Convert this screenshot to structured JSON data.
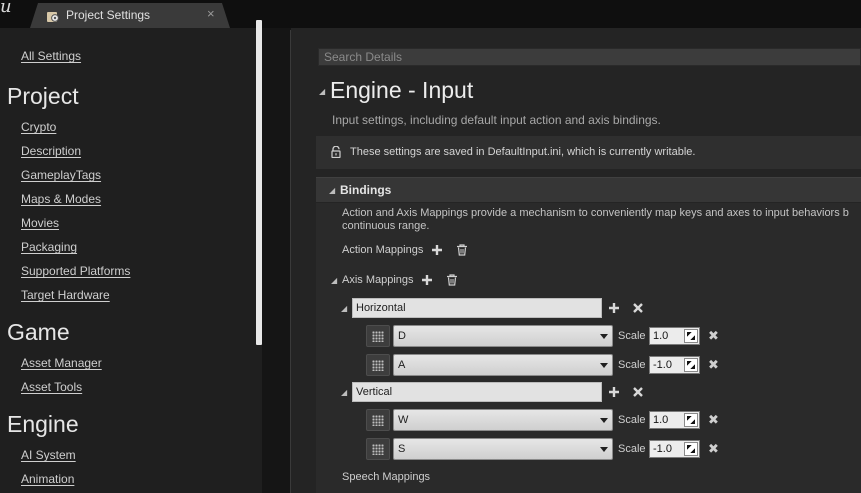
{
  "window": {
    "tab_label": "Project Settings",
    "tab_close": "×"
  },
  "categories": {
    "all_settings": "All Settings",
    "sections": [
      {
        "title": "Project",
        "items": [
          "Crypto",
          "Description",
          "GameplayTags",
          "Maps & Modes",
          "Movies",
          "Packaging",
          "Supported Platforms",
          "Target Hardware"
        ]
      },
      {
        "title": "Game",
        "items": [
          "Asset Manager",
          "Asset Tools"
        ]
      },
      {
        "title": "Engine",
        "items": [
          "AI System",
          "Animation"
        ]
      }
    ]
  },
  "details": {
    "search_placeholder": "Search Details",
    "title": "Engine - Input",
    "description": "Input settings, including default input action and axis bindings.",
    "notice": "These settings are saved in DefaultInput.ini, which is currently writable.",
    "bindings": {
      "title": "Bindings",
      "description_line1": "Action and Axis Mappings provide a mechanism to conveniently map keys and axes to input behaviors b",
      "description_line2": "continuous range.",
      "action_mappings_label": "Action Mappings",
      "axis_mappings_label": "Axis Mappings",
      "speech_mappings_label": "Speech Mappings",
      "axis_mappings": [
        {
          "name": "Horizontal",
          "keys": [
            {
              "key": "D",
              "scale_label": "Scale",
              "scale": "1.0"
            },
            {
              "key": "A",
              "scale_label": "Scale",
              "scale": "-1.0"
            }
          ]
        },
        {
          "name": "Vertical",
          "keys": [
            {
              "key": "W",
              "scale_label": "Scale",
              "scale": "1.0"
            },
            {
              "key": "S",
              "scale_label": "Scale",
              "scale": "-1.0"
            }
          ]
        }
      ]
    }
  },
  "colors": {
    "panel": "#242424",
    "left_panel": "#1f1f1f",
    "header": "#363636",
    "field": "#e2e2e2"
  },
  "icons": {
    "plus": "plus-icon",
    "trash": "trash-icon",
    "close": "close-icon",
    "lock": "lock-icon",
    "settings": "gear-icon"
  }
}
